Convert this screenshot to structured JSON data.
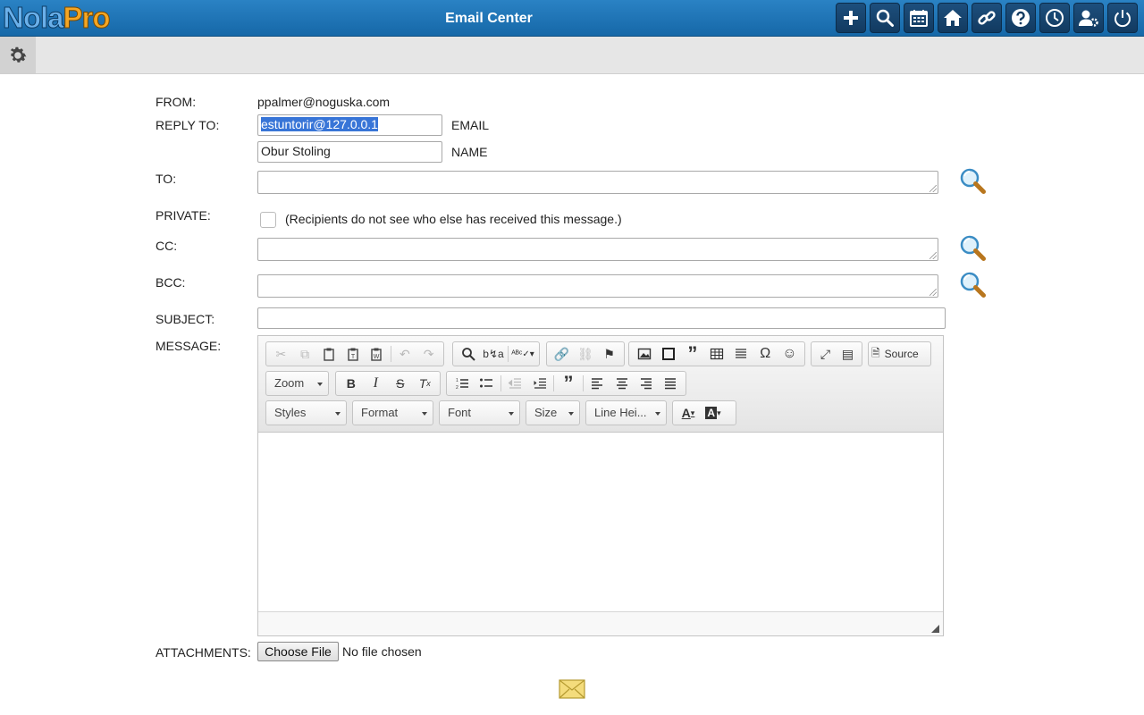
{
  "header": {
    "logo_part1": "Nola",
    "logo_part2": "Pro",
    "title": "Email Center",
    "buttons": [
      {
        "name": "add-icon"
      },
      {
        "name": "search-icon"
      },
      {
        "name": "calendar-icon"
      },
      {
        "name": "home-icon"
      },
      {
        "name": "link-icon"
      },
      {
        "name": "help-icon"
      },
      {
        "name": "clock-icon"
      },
      {
        "name": "user-settings-icon"
      },
      {
        "name": "power-icon"
      }
    ]
  },
  "subbar": {
    "settings_icon": "gear-icon"
  },
  "form": {
    "from_label": "FROM:",
    "from_value": "ppalmer@noguska.com",
    "reply_to_label": "REPLY TO:",
    "reply_email_value": "estuntorir@127.0.0.1",
    "reply_email_suffix": "EMAIL",
    "reply_name_value": "Obur Stoling",
    "reply_name_suffix": "NAME",
    "to_label": "TO:",
    "private_label": "PRIVATE:",
    "private_note": "(Recipients do not see who else has received this message.)",
    "cc_label": "CC:",
    "bcc_label": "BCC:",
    "subject_label": "SUBJECT:",
    "message_label": "MESSAGE:",
    "attachments_label": "ATTACHMENTS:",
    "choose_file_label": "Choose File",
    "no_file_text": "No file chosen"
  },
  "editor": {
    "source_label": "Source",
    "zoom_label": "Zoom",
    "styles_label": "Styles",
    "format_label": "Format",
    "font_label": "Font",
    "size_label": "Size",
    "line_height_label": "Line Hei..."
  },
  "colors": {
    "header_bg": "#1f74b6",
    "selection": "#3875d7"
  }
}
